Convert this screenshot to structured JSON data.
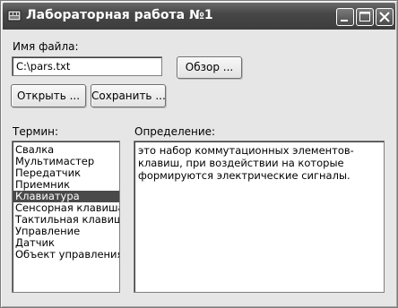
{
  "window": {
    "title": "Лабораторная работа №1"
  },
  "file": {
    "label": "Имя файла:",
    "value": "C:\\pars.txt",
    "browse_label": "Обзор ..."
  },
  "actions": {
    "open_label": "Открыть ...",
    "save_label": "Сохранить ..."
  },
  "terms": {
    "label": "Термин:",
    "items": [
      "Свалка",
      "Мультимастер",
      "Передатчик",
      "Приемник",
      "Клавиатура",
      "Сенсорная клавиша",
      "Тактильная клавиша",
      "Управление",
      "Датчик",
      "Объект управления"
    ],
    "selected": "Клавиатура"
  },
  "definition": {
    "label": "Определение:",
    "text": "это набор коммутационных элементов-клавиш, при воздействии на которые формируются электрические сигналы."
  }
}
